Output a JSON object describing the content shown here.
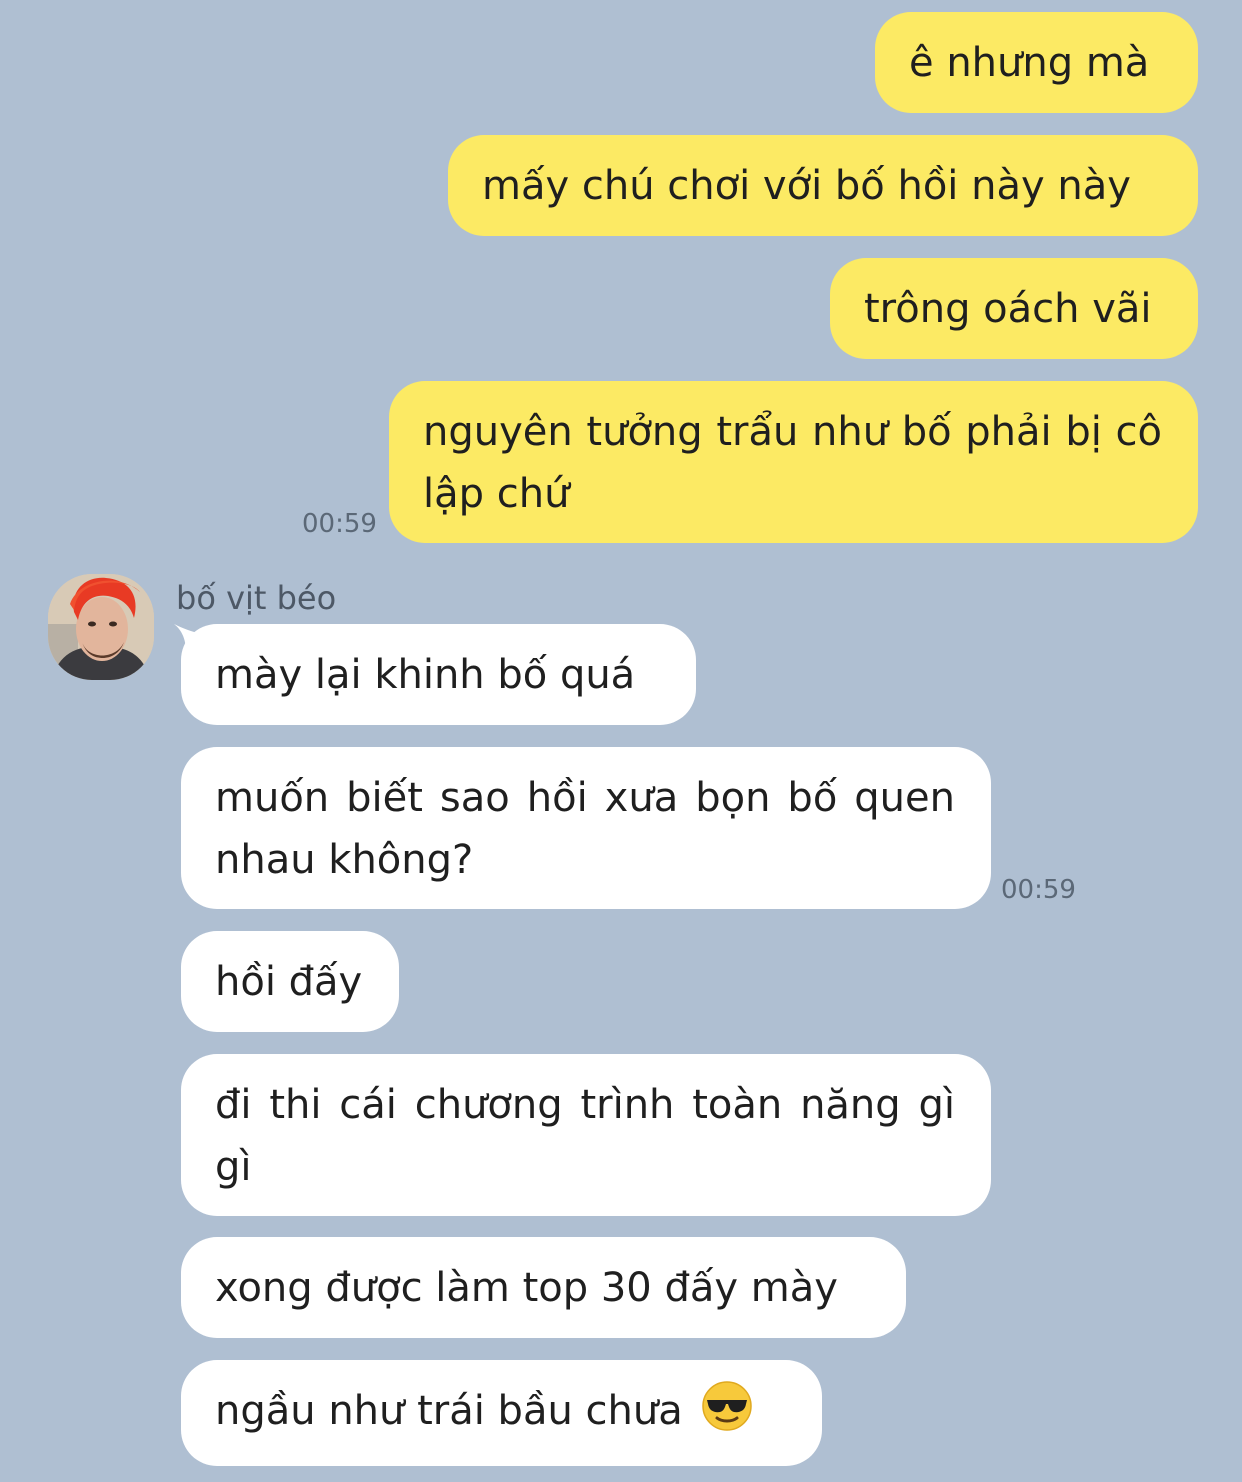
{
  "colors": {
    "background": "#afbfd2",
    "outgoing_bubble": "#fcea64",
    "incoming_bubble": "#ffffff"
  },
  "outgoing": [
    {
      "text": "ê nhưng mà"
    },
    {
      "text": "mấy chú chơi với bố hồi này này"
    },
    {
      "text": "trông oách vãi"
    },
    {
      "text": "nguyên tưởng trẩu như bố phải bị cô lập chứ",
      "time": "00:59"
    }
  ],
  "incoming": {
    "sender_name": "bố vịt béo",
    "avatar_icon": "profile-photo",
    "messages": [
      {
        "text": "mày lại khinh bố quá"
      },
      {
        "text": "muốn biết sao hồi xưa bọn bố quen nhau không?",
        "time": "00:59"
      },
      {
        "text": "hồi đấy"
      },
      {
        "text": "đi thi cái chương trình toàn năng gì gì"
      },
      {
        "text": "xong được làm top 30 đấy mày"
      },
      {
        "text": "ngầu như trái bầu chưa",
        "emoji": "sunglasses-face-icon"
      }
    ]
  }
}
